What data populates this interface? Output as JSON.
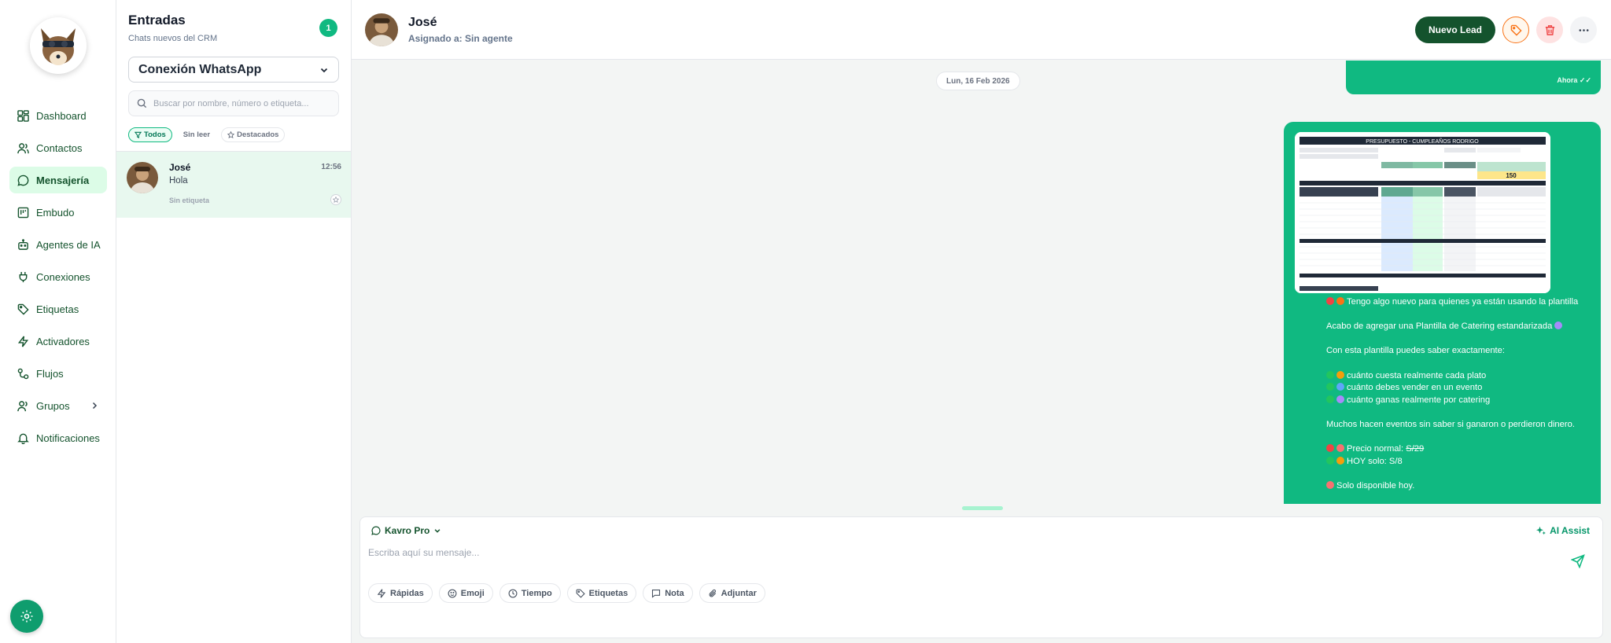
{
  "sidebar": {
    "logo_icon": "fox-mascot-logo",
    "items": [
      {
        "label": "Dashboard",
        "icon": "dashboard-icon"
      },
      {
        "label": "Contactos",
        "icon": "users-icon"
      },
      {
        "label": "Mensajería",
        "icon": "message-icon",
        "active": true
      },
      {
        "label": "Embudo",
        "icon": "funnel-icon"
      },
      {
        "label": "Agentes de IA",
        "icon": "robot-icon"
      },
      {
        "label": "Conexiones",
        "icon": "plug-icon"
      },
      {
        "label": "Etiquetas",
        "icon": "tag-icon"
      },
      {
        "label": "Activadores",
        "icon": "zap-icon"
      },
      {
        "label": "Flujos",
        "icon": "flow-icon"
      },
      {
        "label": "Grupos",
        "icon": "group-icon"
      },
      {
        "label": "Notificaciones",
        "icon": "bell-icon"
      }
    ]
  },
  "inbox": {
    "title": "Entradas",
    "subtitle": "Chats nuevos del CRM",
    "count": "1",
    "connection": "Conexión WhatsApp",
    "search_placeholder": "Buscar por nombre, número o etiqueta...",
    "filters": [
      "Todos",
      "Sin leer",
      "Destacados"
    ],
    "chats": [
      {
        "name": "José",
        "time": "12:56",
        "preview": "Hola",
        "tag": "Sin etiqueta"
      }
    ]
  },
  "chat": {
    "contact_name": "José",
    "assigned": "Asignado a: Sin agente",
    "new_lead_label": "Nuevo Lead",
    "date_label": "Lun, 16 Feb 2026",
    "prev_time": "Ahora",
    "image_title": "PRESUPUESTO - CUMPLEAÑOS RODRIGO",
    "image_highlight": "150",
    "message_lines": [
      "Tengo algo nuevo para quienes ya están usando la plantilla",
      "",
      "Acabo de agregar una Plantilla de Catering estandarizada",
      "",
      "Con esta plantilla puedes saber exactamente:",
      "",
      "cuánto cuesta realmente cada plato",
      "cuánto debes vender en un evento",
      "cuánto ganas realmente por catering",
      "",
      "Muchos hacen eventos sin saber si ganaron o perdieron dinero.",
      "",
      "Precio normal: ",
      "HOY solo: S/8",
      "",
      "Solo disponible hoy."
    ],
    "normal_price": "S/29"
  },
  "composer": {
    "model": "Kavro Pro",
    "assist": "AI Assist",
    "placeholder": "Escriba aquí su mensaje...",
    "tools": [
      "Rápidas",
      "Emoji",
      "Tiempo",
      "Etiquetas",
      "Nota",
      "Adjuntar"
    ]
  },
  "colors": {
    "brand_green": "#10b981",
    "dark_green": "#14532d",
    "active_bg": "#dcfce7"
  }
}
